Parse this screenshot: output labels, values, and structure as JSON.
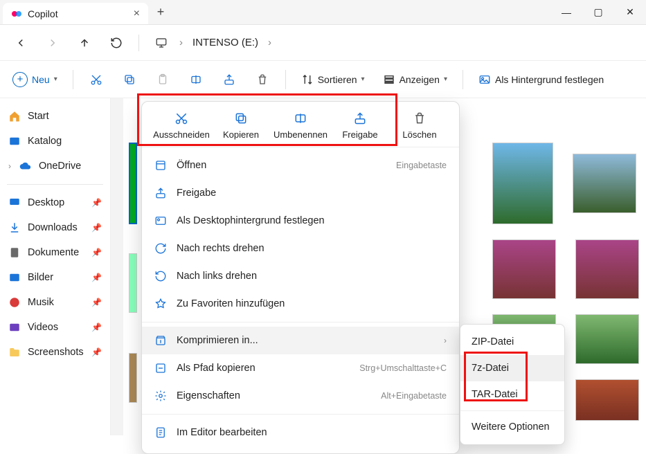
{
  "titlebar": {
    "tab_label": "Copilot"
  },
  "breadcrumb": {
    "location": "INTENSO (E:)"
  },
  "toolbar": {
    "new_label": "Neu",
    "sort_label": "Sortieren",
    "view_label": "Anzeigen",
    "set_bg_label": "Als Hintergrund festlegen"
  },
  "sidebar": {
    "start": "Start",
    "katalog": "Katalog",
    "onedrive": "OneDrive",
    "desktop": "Desktop",
    "downloads": "Downloads",
    "dokumente": "Dokumente",
    "bilder": "Bilder",
    "musik": "Musik",
    "videos": "Videos",
    "screenshots": "Screenshots"
  },
  "context_menu": {
    "actions": {
      "cut": "Ausschneiden",
      "copy": "Kopieren",
      "rename": "Umbenennen",
      "share": "Freigabe",
      "delete": "Löschen"
    },
    "open": "Öffnen",
    "open_accel": "Eingabetaste",
    "share": "Freigabe",
    "set_desktop_bg": "Als Desktophintergrund festlegen",
    "rotate_right": "Nach rechts drehen",
    "rotate_left": "Nach links drehen",
    "add_fav": "Zu Favoriten hinzufügen",
    "compress": "Komprimieren in...",
    "copy_path": "Als Pfad kopieren",
    "copy_path_accel": "Strg+Umschalttaste+C",
    "properties": "Eigenschaften",
    "properties_accel": "Alt+Eingabetaste",
    "edit_editor": "Im Editor bearbeiten"
  },
  "submenu": {
    "zip": "ZIP-Datei",
    "sevenz": "7z-Datei",
    "tar": "TAR-Datei",
    "more": "Weitere Optionen"
  }
}
